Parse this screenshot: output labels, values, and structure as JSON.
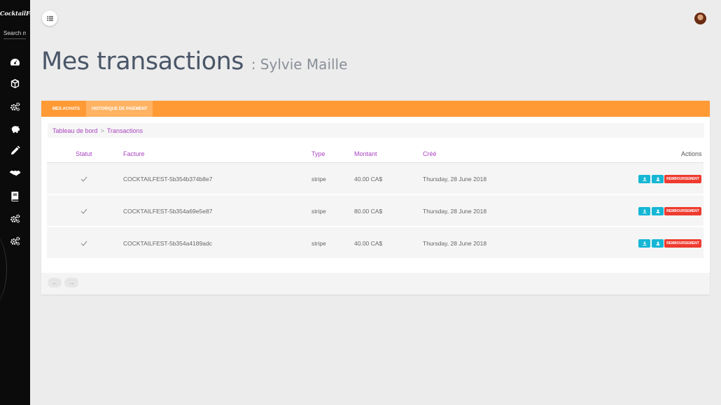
{
  "sidebar": {
    "brand": "CocktailFest",
    "search_placeholder": "Search m",
    "items": [
      {
        "icon": "dashboard-icon"
      },
      {
        "icon": "cube-icon"
      },
      {
        "icon": "gears-icon"
      },
      {
        "icon": "piggy-bank-icon"
      },
      {
        "icon": "pencil-icon"
      },
      {
        "icon": "handshake-icon"
      },
      {
        "icon": "book-icon"
      },
      {
        "icon": "gears-icon"
      },
      {
        "icon": "gears-icon"
      }
    ]
  },
  "header": {
    "title": "Mes transactions",
    "subtitle": ": Sylvie Maille"
  },
  "tabs": [
    {
      "label": "MES ACHATS",
      "active": false
    },
    {
      "label": "HISTORIQUE DE PAIEMENT",
      "active": true
    }
  ],
  "breadcrumb": {
    "items": [
      "Tableau de bord",
      "Transactions"
    ],
    "separator": ">"
  },
  "table": {
    "columns": {
      "statut": "Statut",
      "facture": "Facture",
      "type": "Type",
      "montant": "Montant",
      "cree": "Créé",
      "actions": "Actions"
    },
    "rows": [
      {
        "facture": "COCKTAILFEST-5b354b374b8e7",
        "type": "stripe",
        "montant": "40.00 CA$",
        "cree": "Thursday, 28 June 2018",
        "refund_label": "REMBOURSEMENT"
      },
      {
        "facture": "COCKTAILFEST-5b354a69e5e87",
        "type": "stripe",
        "montant": "80.00 CA$",
        "cree": "Thursday, 28 June 2018",
        "refund_label": "REMBOURSEMENT"
      },
      {
        "facture": "COCKTAILFEST-5b354a4189adc",
        "type": "stripe",
        "montant": "40.00 CA$",
        "cree": "Thursday, 28 June 2018",
        "refund_label": "REMBOURSEMENT"
      }
    ]
  },
  "pagination": {
    "prev": "←",
    "next": "→"
  },
  "colors": {
    "accent": "#ff9a35",
    "link": "#aa44c0",
    "download_button": "#15b7d4",
    "refund_button": "#ef3b2f",
    "sidebar": "#0b0b0b"
  }
}
